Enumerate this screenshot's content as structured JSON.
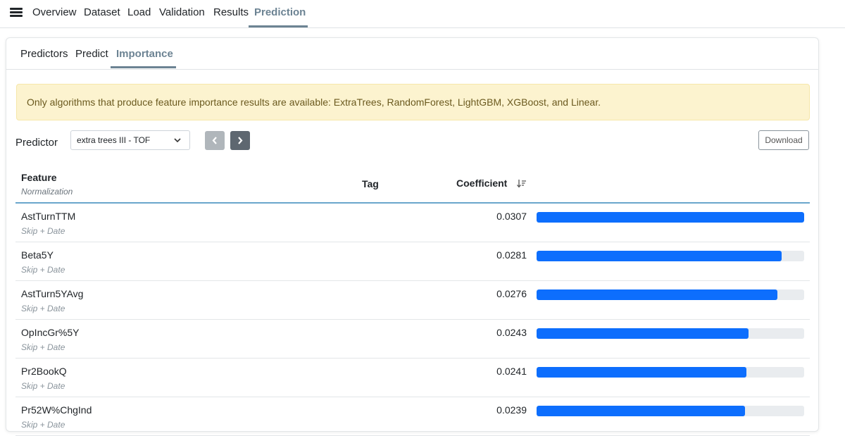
{
  "nav": {
    "items": [
      "Overview",
      "Dataset",
      "Load",
      "Validation",
      "Results",
      "Prediction"
    ],
    "active": "Prediction"
  },
  "subtabs": {
    "items": [
      "Predictors",
      "Predict",
      "Importance"
    ],
    "active": "Importance"
  },
  "alert": {
    "text": "Only algorithms that produce feature importance results are available: ExtraTrees, RandomForest, LightGBM, XGBoost, and Linear."
  },
  "predictor": {
    "label": "Predictor",
    "selected": "extra trees III - TOF",
    "download_label": "Download"
  },
  "table": {
    "headers": {
      "feature": "Feature",
      "normalization": "Normalization",
      "tag": "Tag",
      "coefficient": "Coefficient"
    },
    "rows": [
      {
        "feature": "AstTurnTTM",
        "normalization": "Skip + Date",
        "tag": "",
        "coefficient": "0.0307",
        "bar_fraction": 1.0
      },
      {
        "feature": "Beta5Y",
        "normalization": "Skip + Date",
        "tag": "",
        "coefficient": "0.0281",
        "bar_fraction": 0.915
      },
      {
        "feature": "AstTurn5YAvg",
        "normalization": "Skip + Date",
        "tag": "",
        "coefficient": "0.0276",
        "bar_fraction": 0.899
      },
      {
        "feature": "OpIncGr%5Y",
        "normalization": "Skip + Date",
        "tag": "",
        "coefficient": "0.0243",
        "bar_fraction": 0.791
      },
      {
        "feature": "Pr2BookQ",
        "normalization": "Skip + Date",
        "tag": "",
        "coefficient": "0.0241",
        "bar_fraction": 0.785
      },
      {
        "feature": "Pr52W%ChgInd",
        "normalization": "Skip + Date",
        "tag": "",
        "coefficient": "0.0239",
        "bar_fraction": 0.778
      }
    ]
  },
  "colors": {
    "accent": "#6c8393",
    "bar": "#0d6efd",
    "bar_track": "#e9ecef",
    "alert_bg": "#fcf3cf"
  }
}
